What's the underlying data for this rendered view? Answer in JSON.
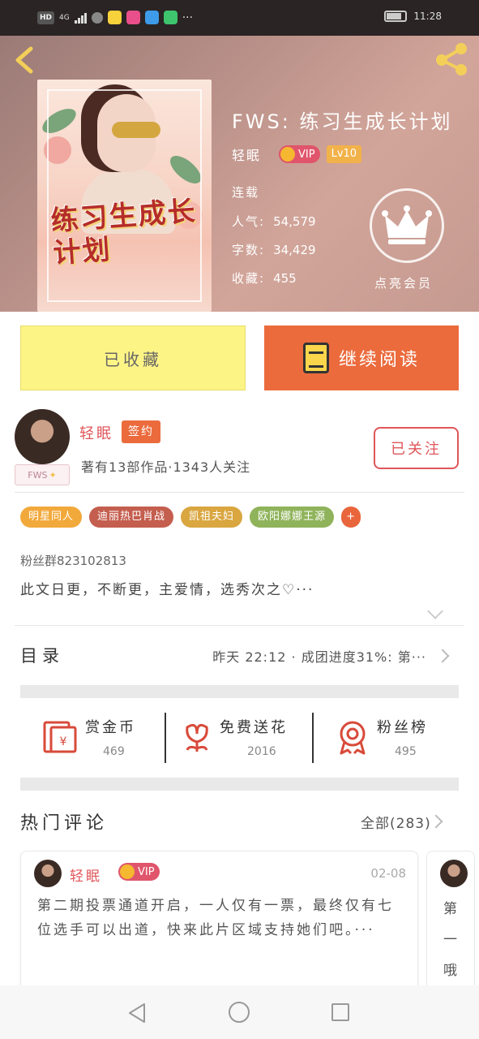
{
  "status_bar": {
    "network": "HD",
    "signal": "4G",
    "time": "11:28"
  },
  "header": {
    "book_title": "FWS: 练习生成长计划",
    "author": "轻眠",
    "vip_label": "VIP",
    "level": "Lv10",
    "status": "连载",
    "popularity_label": "人气:",
    "popularity": "54,579",
    "word_count_label": "字数:",
    "word_count": "34,429",
    "favorites_label": "收藏:",
    "favorites": "455",
    "member_label": "点亮会员",
    "cover_title": "练习生成长计划"
  },
  "actions": {
    "collected_label": "已收藏",
    "continue_label": "继续阅读"
  },
  "author_section": {
    "name": "轻眠",
    "signed_label": "签约",
    "stats": "著有13部作品·1343人关注",
    "follow_label": "已关注",
    "fws_tag": "FWS"
  },
  "tags": [
    {
      "label": "明星同人",
      "color": "#f2a93b"
    },
    {
      "label": "迪丽热巴肖战",
      "color": "#c45e4e"
    },
    {
      "label": "凯祖夫妇",
      "color": "#d9a640"
    },
    {
      "label": "欧阳娜娜王源",
      "color": "#8fb35a"
    },
    {
      "label": "+",
      "color": "#e9653c"
    }
  ],
  "synopsis": {
    "fan_group": "粉丝群823102813",
    "summary": "此文日更，不断更，主爱情，选秀次之♡···"
  },
  "toc": {
    "label": "目录",
    "latest": "昨天 22:12 · 成团进度31%: 第···"
  },
  "stats": [
    {
      "label": "赏金币",
      "count": "469",
      "icon": "red-envelope-icon"
    },
    {
      "label": "免费送花",
      "count": "2016",
      "icon": "flower-icon"
    },
    {
      "label": "粉丝榜",
      "count": "495",
      "icon": "medal-icon"
    }
  ],
  "comments": {
    "title": "热门评论",
    "all_label": "全部(283)",
    "items": [
      {
        "user": "轻眠",
        "vip": "VIP",
        "date": "02-08",
        "text": "第二期投票通道开启，一人仅有一票，最终仅有七位选手可以出道，快来此片区域支持她们吧。···"
      },
      {
        "text_partial": "第一哦"
      }
    ]
  },
  "colors": {
    "accent": "#eb6b3d",
    "author_red": "#e0565a",
    "collected_yellow": "#fdf486"
  }
}
